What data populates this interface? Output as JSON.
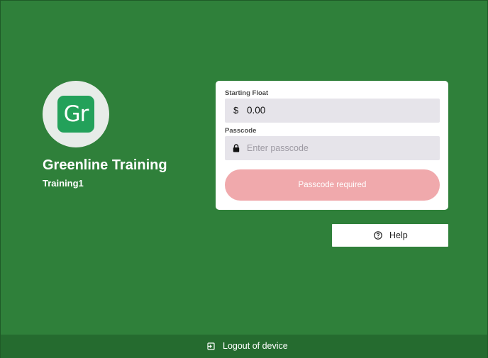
{
  "colors": {
    "background": "#2f803a",
    "footer": "#256b2f",
    "logo_tile": "#23a15a",
    "field_bg": "#e6e4ea",
    "submit_disabled": "#f0a9ac"
  },
  "brand": {
    "logo_text": "Gr",
    "org_name": "Greenline Training",
    "user_name": "Training1"
  },
  "form": {
    "starting_float": {
      "label": "Starting Float",
      "currency_symbol": "$",
      "value": "0.00"
    },
    "passcode": {
      "label": "Passcode",
      "icon": "lock-icon",
      "placeholder": "Enter passcode",
      "value": ""
    },
    "submit_label": "Passcode required"
  },
  "help": {
    "icon": "question-circle-icon",
    "label": "Help"
  },
  "footer": {
    "icon": "logout-icon",
    "logout_label": "Logout of device"
  }
}
